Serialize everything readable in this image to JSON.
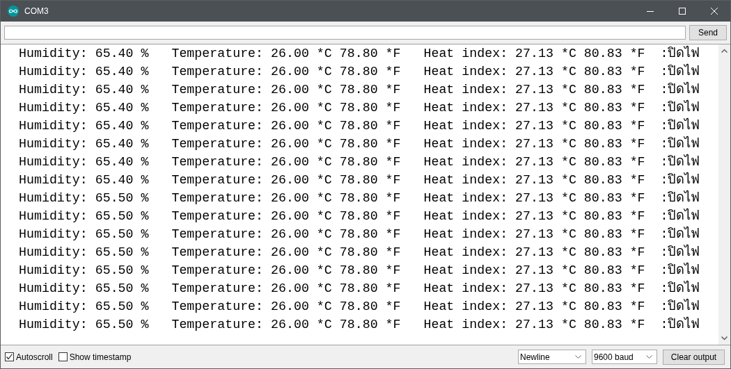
{
  "window": {
    "title": "COM3"
  },
  "send_button": "Send",
  "output_lines": [
    "Humidity: 65.40 %   Temperature: 26.00 *C 78.80 *F   Heat index: 27.13 *C 80.83 *F  :ปิดไฟ",
    "Humidity: 65.40 %   Temperature: 26.00 *C 78.80 *F   Heat index: 27.13 *C 80.83 *F  :ปิดไฟ",
    "Humidity: 65.40 %   Temperature: 26.00 *C 78.80 *F   Heat index: 27.13 *C 80.83 *F  :ปิดไฟ",
    "Humidity: 65.40 %   Temperature: 26.00 *C 78.80 *F   Heat index: 27.13 *C 80.83 *F  :ปิดไฟ",
    "Humidity: 65.40 %   Temperature: 26.00 *C 78.80 *F   Heat index: 27.13 *C 80.83 *F  :ปิดไฟ",
    "Humidity: 65.40 %   Temperature: 26.00 *C 78.80 *F   Heat index: 27.13 *C 80.83 *F  :ปิดไฟ",
    "Humidity: 65.40 %   Temperature: 26.00 *C 78.80 *F   Heat index: 27.13 *C 80.83 *F  :ปิดไฟ",
    "Humidity: 65.40 %   Temperature: 26.00 *C 78.80 *F   Heat index: 27.13 *C 80.83 *F  :ปิดไฟ",
    "Humidity: 65.50 %   Temperature: 26.00 *C 78.80 *F   Heat index: 27.13 *C 80.83 *F  :ปิดไฟ",
    "Humidity: 65.50 %   Temperature: 26.00 *C 78.80 *F   Heat index: 27.13 *C 80.83 *F  :ปิดไฟ",
    "Humidity: 65.50 %   Temperature: 26.00 *C 78.80 *F   Heat index: 27.13 *C 80.83 *F  :ปิดไฟ",
    "Humidity: 65.50 %   Temperature: 26.00 *C 78.80 *F   Heat index: 27.13 *C 80.83 *F  :ปิดไฟ",
    "Humidity: 65.50 %   Temperature: 26.00 *C 78.80 *F   Heat index: 27.13 *C 80.83 *F  :ปิดไฟ",
    "Humidity: 65.50 %   Temperature: 26.00 *C 78.80 *F   Heat index: 27.13 *C 80.83 *F  :ปิดไฟ",
    "Humidity: 65.50 %   Temperature: 26.00 *C 78.80 *F   Heat index: 27.13 *C 80.83 *F  :ปิดไฟ",
    "Humidity: 65.50 %   Temperature: 26.00 *C 78.80 *F   Heat index: 27.13 *C 80.83 *F  :ปิดไฟ"
  ],
  "options": [
    {
      "label": "Autoscroll",
      "checked": true
    },
    {
      "label": "Show timestamp",
      "checked": false
    }
  ],
  "line_ending": "Newline",
  "baud_rate": "9600 baud",
  "clear_button": "Clear output"
}
